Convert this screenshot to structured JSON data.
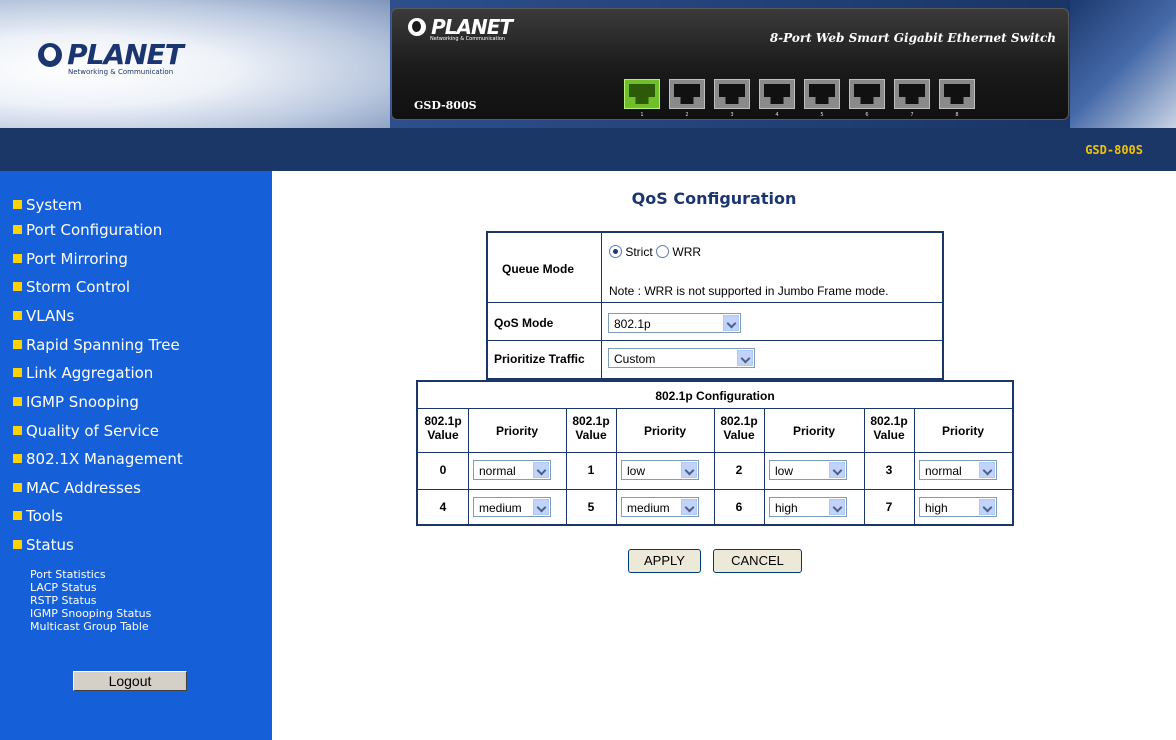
{
  "brand": {
    "name": "PLANET",
    "tagline": "Networking & Communication"
  },
  "device": {
    "title": "8-Port Web Smart Gigabit Ethernet Switch",
    "model": "GSD-800S",
    "ports": [
      {
        "num": "1",
        "active": true
      },
      {
        "num": "2",
        "active": false
      },
      {
        "num": "3",
        "active": false
      },
      {
        "num": "4",
        "active": false
      },
      {
        "num": "5",
        "active": false
      },
      {
        "num": "6",
        "active": false
      },
      {
        "num": "7",
        "active": false
      },
      {
        "num": "8",
        "active": false
      }
    ]
  },
  "topbar": {
    "model": "GSD-800S"
  },
  "sidebar": {
    "items": [
      {
        "label": "System"
      },
      {
        "label": "Port Configuration"
      },
      {
        "label": "Port Mirroring"
      },
      {
        "label": "Storm Control"
      },
      {
        "label": "VLANs"
      },
      {
        "label": "Rapid Spanning Tree"
      },
      {
        "label": "Link Aggregation"
      },
      {
        "label": "IGMP Snooping"
      },
      {
        "label": "Quality of Service"
      },
      {
        "label": "802.1X Management"
      },
      {
        "label": "MAC Addresses"
      },
      {
        "label": "Tools"
      },
      {
        "label": "Status"
      }
    ],
    "status_subitems": [
      {
        "label": "Port Statistics"
      },
      {
        "label": "LACP Status"
      },
      {
        "label": "RSTP Status"
      },
      {
        "label": "IGMP Snooping Status"
      },
      {
        "label": "Multicast Group Table"
      }
    ],
    "logout_label": "Logout"
  },
  "main": {
    "title": "QoS Configuration",
    "queue_mode": {
      "label": "Queue Mode",
      "options": [
        "Strict",
        "WRR"
      ],
      "selected": "Strict",
      "note": "Note : WRR is not supported in Jumbo Frame mode."
    },
    "qos_mode": {
      "label": "QoS Mode",
      "value": "802.1p"
    },
    "prioritize_traffic": {
      "label": "Prioritize Traffic",
      "value": "Custom"
    },
    "config": {
      "title": "802.1p Configuration",
      "value_header": "802.1p Value",
      "priority_header": "Priority",
      "rows": [
        [
          {
            "value": "0",
            "priority": "normal"
          },
          {
            "value": "1",
            "priority": "low"
          },
          {
            "value": "2",
            "priority": "low"
          },
          {
            "value": "3",
            "priority": "normal"
          }
        ],
        [
          {
            "value": "4",
            "priority": "medium"
          },
          {
            "value": "5",
            "priority": "medium"
          },
          {
            "value": "6",
            "priority": "high"
          },
          {
            "value": "7",
            "priority": "high"
          }
        ]
      ]
    },
    "apply_label": "APPLY",
    "cancel_label": "CANCEL"
  }
}
